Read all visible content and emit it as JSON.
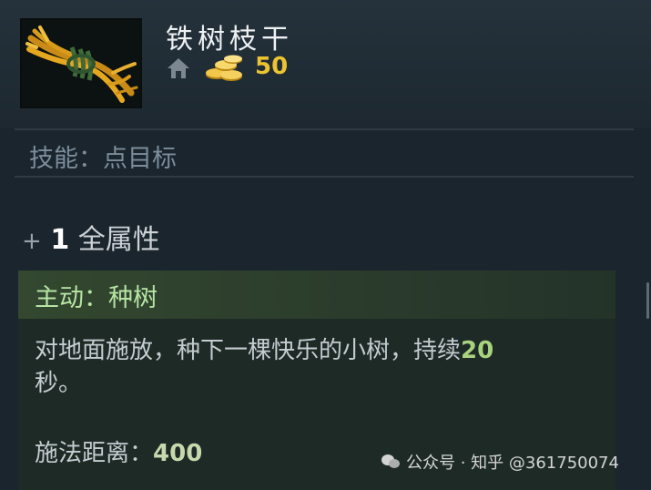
{
  "item": {
    "name": "铁树枝干",
    "cost": "50",
    "skill_type": "技能：点目标",
    "attribute_prefix": "+",
    "attribute_value": "1",
    "attribute_label": "全属性"
  },
  "active": {
    "title": "主动：种树",
    "desc_text": "对地面施放，种下一棵快乐的小树，持续",
    "desc_duration": "20",
    "desc_unit": "秒。",
    "range_label": "施法距离：",
    "range_value": "400"
  },
  "watermark": {
    "text": "公众号 · 知乎 @361750074"
  },
  "colors": {
    "gold": "#ecc430",
    "active_green": "#b7e4a5",
    "value_green": "#a9d27f"
  },
  "icons": [
    "item-iron-branch-icon",
    "home-icon",
    "gold-coins-icon",
    "wechat-icon"
  ]
}
